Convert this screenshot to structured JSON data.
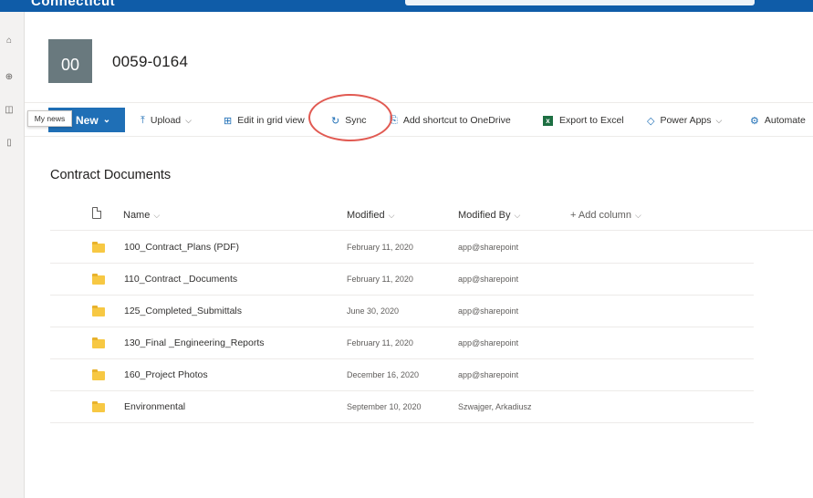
{
  "topbar": {
    "title": "Connecticut"
  },
  "site": {
    "logo_text": "00",
    "title": "0059-0164"
  },
  "tooltip": "My news",
  "commands": {
    "new_label": "New",
    "upload_label": "Upload",
    "grid_label": "Edit in grid view",
    "sync_label": "Sync",
    "shortcut_label": "Add shortcut to OneDrive",
    "excel_label": "Export to Excel",
    "powerapps_label": "Power Apps",
    "automate_label": "Automate"
  },
  "library": {
    "title": "Contract Documents",
    "columns": {
      "name": "Name",
      "modified": "Modified",
      "modified_by": "Modified By",
      "add_column": "+ Add column"
    },
    "rows": [
      {
        "name": "100_Contract_Plans (PDF)",
        "modified": "February 11, 2020",
        "modified_by": "app@sharepoint"
      },
      {
        "name": "110_Contract _Documents",
        "modified": "February 11, 2020",
        "modified_by": "app@sharepoint"
      },
      {
        "name": "125_Completed_Submittals",
        "modified": "June 30, 2020",
        "modified_by": "app@sharepoint"
      },
      {
        "name": "130_Final _Engineering_Reports",
        "modified": "February 11, 2020",
        "modified_by": "app@sharepoint"
      },
      {
        "name": "160_Project Photos",
        "modified": "December 16, 2020",
        "modified_by": "app@sharepoint"
      },
      {
        "name": "Environmental",
        "modified": "September 10, 2020",
        "modified_by": "Szwajger, Arkadiusz"
      }
    ]
  },
  "colors": {
    "accent": "#1f6fb6",
    "suitebar": "#0f5ca8",
    "highlight_circle": "#e15a52",
    "folder": "#f7c843"
  },
  "icons": [
    "home-icon",
    "globe-icon",
    "news-icon",
    "doc-icon",
    "upload-icon",
    "grid-icon",
    "sync-icon",
    "shortcut-icon",
    "excel-icon",
    "powerapps-icon",
    "automate-icon",
    "folder-icon",
    "file-icon"
  ]
}
